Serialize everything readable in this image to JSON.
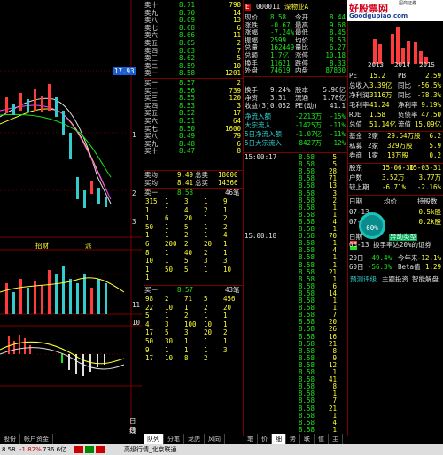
{
  "watermark": {
    "site_label": "好股票网",
    "url_label": "Goodgupiao.com",
    "tiny_label": "招商证券..."
  },
  "left_chart": {
    "price_marker": "17.93",
    "markers": [
      "1",
      "2",
      "3"
    ],
    "bottom_labels": {
      "left": "招财",
      "right": "派"
    },
    "box_labels": [
      "11",
      "10"
    ],
    "tail_labels": [
      "日线",
      "日线",
      "日线"
    ]
  },
  "order_book": {
    "asks": [
      {
        "label": "卖十",
        "price": "8.71",
        "vol": "798"
      },
      {
        "label": "卖九",
        "price": "8.70",
        "vol": "14"
      },
      {
        "label": "卖八",
        "price": "8.69",
        "vol": "13"
      },
      {
        "label": "卖七",
        "price": "8.68",
        "vol": "6"
      },
      {
        "label": "卖六",
        "price": "8.66",
        "vol": "11"
      },
      {
        "label": "卖五",
        "price": "8.65",
        "vol": "2"
      },
      {
        "label": "卖四",
        "price": "8.63",
        "vol": "7"
      },
      {
        "label": "卖三",
        "price": "8.62",
        "vol": "5"
      },
      {
        "label": "卖二",
        "price": "8.59",
        "vol": "10"
      },
      {
        "label": "卖一",
        "price": "8.58",
        "vol": "1201"
      }
    ],
    "bids": [
      {
        "label": "买一",
        "price": "8.57",
        "vol": "2"
      },
      {
        "label": "买二",
        "price": "8.56",
        "vol": "739"
      },
      {
        "label": "买三",
        "price": "8.55",
        "vol": "120"
      },
      {
        "label": "买四",
        "price": "8.53",
        "vol": "3"
      },
      {
        "label": "买五",
        "price": "8.52",
        "vol": "17"
      },
      {
        "label": "买六",
        "price": "8.51",
        "vol": "64"
      },
      {
        "label": "买七",
        "price": "8.50",
        "vol": "1600"
      },
      {
        "label": "买八",
        "price": "8.49",
        "vol": "79"
      },
      {
        "label": "买九",
        "price": "8.48",
        "vol": "6"
      },
      {
        "label": "买十",
        "price": "8.47",
        "vol": "8"
      }
    ],
    "avg_row": [
      {
        "label": "卖均",
        "price": "9.49",
        "k": "总卖",
        "v": "18000"
      },
      {
        "label": "买均",
        "price": "8.41",
        "k": "总买",
        "v": "14366"
      }
    ],
    "queue_sell": {
      "label": "卖一",
      "price": "8.58",
      "count": "46笔",
      "grid": [
        [
          "315",
          "1",
          "3",
          "1",
          "9"
        ],
        [
          "1",
          "1",
          "4",
          "2",
          "1"
        ],
        [
          "1",
          "6",
          "20",
          "1",
          "2"
        ],
        [
          "50",
          "1",
          "5",
          "1",
          "2"
        ],
        [
          "1",
          "1",
          "2",
          "1",
          "4"
        ],
        [
          "6",
          "200",
          "2",
          "20",
          "1"
        ],
        [
          "8",
          "1",
          "40",
          "2",
          "1"
        ],
        [
          "10",
          "1",
          "5",
          "3",
          "3"
        ],
        [
          "1",
          "50",
          "5",
          "1",
          "10"
        ],
        [
          "1",
          "",
          "",
          "",
          ""
        ]
      ]
    },
    "queue_buy": {
      "label": "买一",
      "price": "8.57",
      "count": "43笔",
      "grid": [
        [
          "98",
          "2",
          "71",
          "5",
          "456"
        ],
        [
          "22",
          "10",
          "1",
          "2",
          "20"
        ],
        [
          "5",
          "1",
          "2",
          "1",
          "1"
        ],
        [
          "4",
          "3",
          "100",
          "10",
          "1"
        ],
        [
          "17",
          "5",
          "3",
          "20",
          "2"
        ],
        [
          "50",
          "30",
          "1",
          "1",
          "1"
        ],
        [
          "9",
          "1",
          "1",
          "1",
          "3"
        ],
        [
          "17",
          "10",
          "8",
          "2",
          ""
        ]
      ]
    }
  },
  "stock": {
    "code": "000011",
    "name": "深物业A",
    "fields": [
      [
        "现价",
        "8.58",
        "今开",
        "8.44"
      ],
      [
        "涨跌",
        "-0.67",
        "最高",
        "9.68"
      ],
      [
        "涨幅",
        "-7.24%",
        "最低",
        "8.45"
      ],
      [
        "振幅",
        "2599",
        "均价",
        "8.53"
      ],
      [
        "总量",
        "162449",
        "量比",
        "6.27"
      ],
      [
        "总额",
        "1.7亿",
        "涨停",
        "10.18"
      ],
      [
        "换手",
        "11621",
        "跌停",
        "8.33"
      ],
      [
        "外盘",
        "74619",
        "内盘",
        "87830"
      ]
    ],
    "fields2": [
      [
        "换手",
        "9.24%",
        "股本",
        "5.96亿"
      ],
      [
        "净资",
        "3.31",
        "流通",
        "1.76亿"
      ],
      [
        "收益(3)",
        "0.052",
        "PE(动)",
        "41.1"
      ]
    ],
    "flows": [
      {
        "label": "净流入额",
        "value": "-2213万",
        "pct": "-15%"
      },
      {
        "label": "大宗流入",
        "value": "-1425万",
        "pct": "-11%"
      },
      {
        "label": "5日净流入额",
        "value": "-1.07亿",
        "pct": "-11%"
      },
      {
        "label": "5日大宗流入",
        "value": "-8427万",
        "pct": "-12%"
      }
    ]
  },
  "ticks": [
    [
      "15:00:17",
      "8",
      "8.58",
      "5",
      ""
    ],
    [
      "",
      "",
      "8.58",
      "5",
      ""
    ],
    [
      "",
      "",
      "8.58",
      "28",
      ""
    ],
    [
      "",
      "",
      "8.58",
      "71",
      ""
    ],
    [
      "",
      "",
      "8.58",
      "13",
      ""
    ],
    [
      "",
      "",
      "8.58",
      "3",
      ""
    ],
    [
      "",
      "",
      "8.58",
      "2",
      ""
    ],
    [
      "",
      "",
      "8.58",
      "1",
      ""
    ],
    [
      "",
      "",
      "8.58",
      "1",
      ""
    ],
    [
      "",
      "",
      "8.58",
      "4",
      ""
    ],
    [
      "",
      "",
      "8.58",
      "1",
      ""
    ],
    [
      "15:00:18",
      "",
      "8.58",
      "70",
      ""
    ],
    [
      "",
      "",
      "8.58",
      "1",
      ""
    ],
    [
      "",
      "",
      "8.58",
      "4",
      ""
    ],
    [
      "",
      "",
      "8.58",
      "1",
      ""
    ],
    [
      "",
      "",
      "8.58",
      "1",
      ""
    ],
    [
      "",
      "",
      "8.58",
      "21",
      ""
    ],
    [
      "",
      "",
      "8.58",
      "1",
      ""
    ],
    [
      "",
      "",
      "8.58",
      "6",
      ""
    ],
    [
      "",
      "",
      "8.58",
      "14",
      ""
    ],
    [
      "",
      "",
      "8.58",
      "1",
      ""
    ],
    [
      "",
      "",
      "8.58",
      "1",
      ""
    ],
    [
      "",
      "",
      "8.58",
      "7",
      ""
    ],
    [
      "",
      "",
      "8.58",
      "20",
      ""
    ],
    [
      "",
      "",
      "8.58",
      "26",
      ""
    ],
    [
      "",
      "",
      "8.58",
      "16",
      ""
    ],
    [
      "",
      "",
      "8.58",
      "21",
      ""
    ],
    [
      "",
      "",
      "8.58",
      "8",
      ""
    ],
    [
      "",
      "",
      "8.58",
      "9",
      ""
    ],
    [
      "",
      "",
      "8.58",
      "12",
      ""
    ],
    [
      "",
      "",
      "8.58",
      "1",
      ""
    ],
    [
      "",
      "",
      "8.58",
      "41",
      ""
    ],
    [
      "",
      "",
      "8.58",
      "8",
      ""
    ],
    [
      "",
      "",
      "8.58",
      "1",
      ""
    ],
    [
      "",
      "",
      "8.58",
      "7",
      ""
    ],
    [
      "",
      "",
      "8.58",
      "21",
      ""
    ],
    [
      "",
      "",
      "8.58",
      "1",
      ""
    ],
    [
      "",
      "",
      "8.58",
      "4",
      ""
    ],
    [
      "",
      "",
      "8.58",
      "1",
      ""
    ]
  ],
  "fundamentals": {
    "mini_chart_years": [
      "2013",
      "2014",
      "2015"
    ],
    "rows": [
      [
        "PE",
        "15.2",
        "PB",
        "2.59"
      ],
      [
        "总收入",
        "3.39亿",
        "同比",
        "-56.5%"
      ],
      [
        "净利润",
        "3116万",
        "同比",
        "-78.3%"
      ],
      [
        "毛利率",
        "41.24",
        "净利率",
        "9.19%"
      ],
      [
        "ROE",
        "1.58",
        "负债率",
        "47.50"
      ],
      [
        "总值",
        "51.14亿",
        "流值",
        "15.09亿"
      ]
    ],
    "holders": [
      [
        "基金",
        "2家",
        "29.64万股",
        "6.2"
      ],
      [
        "私募",
        "2家",
        "329万股",
        "5.9"
      ],
      [
        "券商",
        "1家",
        "13万股",
        "0.2"
      ]
    ],
    "events": [
      [
        "股东",
        "15-06-30",
        "15-03-31"
      ],
      [
        "户数",
        "3.52万",
        "3.77万"
      ],
      [
        "较上期",
        "-6.71%",
        "-2.16%"
      ]
    ],
    "calendar_head": [
      "日期",
      "均价",
      "持股数"
    ],
    "calendar": [
      [
        "07-13",
        "",
        "0.5k股"
      ],
      [
        "07-10",
        "",
        "0.2k股"
      ]
    ],
    "gauge_pct": "60%",
    "alert": {
      "date_head": "日期",
      "date": "08-13",
      "title": "异动类型",
      "text": "换手率达20%的证券"
    },
    "stats": [
      [
        "20日",
        "-49.4%",
        "今年来",
        "-12.1%"
      ],
      [
        "60日",
        "-56.3%",
        "Beta值",
        "1.29"
      ]
    ],
    "links": [
      "预测评级",
      "主题投资",
      "智能解盘"
    ]
  },
  "tabs_left": [
    "股份",
    "帐户资金"
  ],
  "tabs_mid": [
    "队列",
    "分笔",
    "龙虎",
    "风向",
    "..."
  ],
  "tabs_mid2": [
    "笔",
    "价",
    "细",
    "势",
    "联",
    "值",
    "主",
    "筹"
  ],
  "status": {
    "left": "8.58",
    "chg": "-1.82%",
    "amt": "736.6亿",
    "blocks": [
      "",
      "",
      ""
    ],
    "center": "高级行情_北京联通"
  },
  "colors": {
    "up": "#ff3b3b",
    "down": "#19e619",
    "bg": "#000000",
    "grid": "#7a0000"
  }
}
